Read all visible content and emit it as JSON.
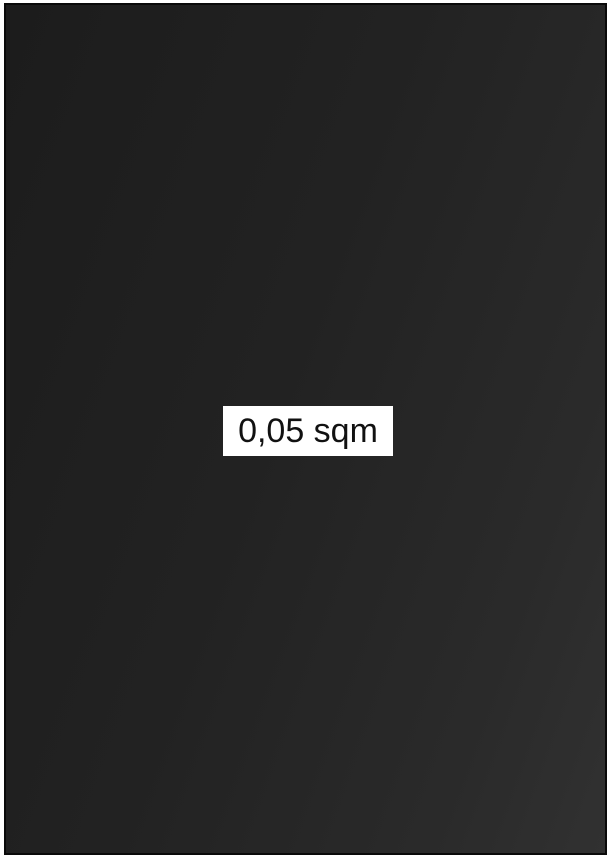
{
  "panel": {
    "area_label": "0,05 sqm",
    "background_color": "#252525",
    "label_background_color": "#ffffff"
  }
}
